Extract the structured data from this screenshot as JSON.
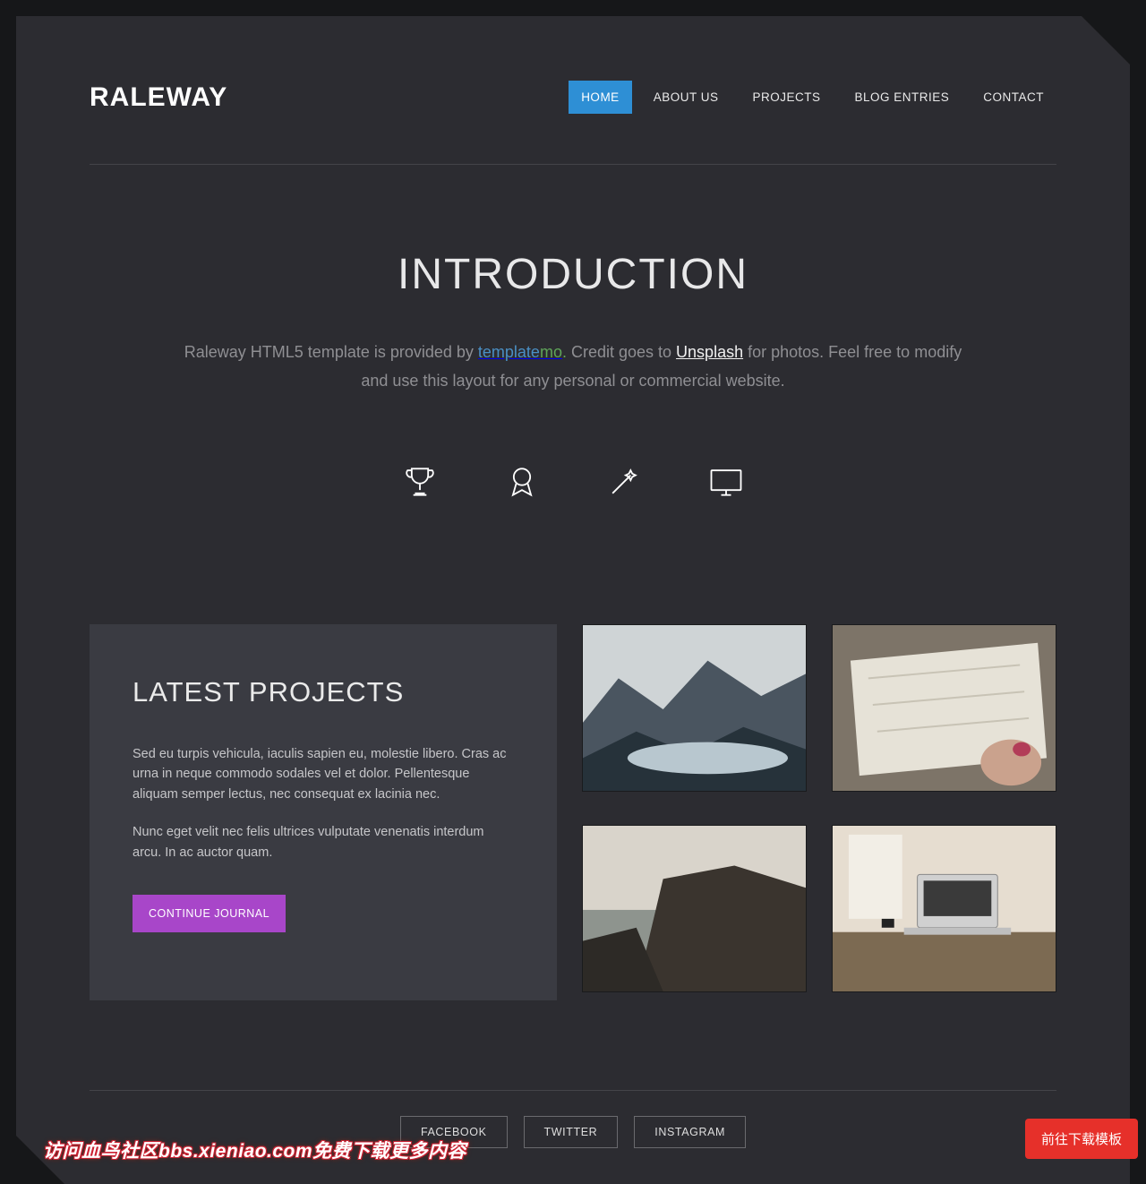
{
  "header": {
    "logo": "RALEWAY",
    "nav": {
      "home": "HOME",
      "about": "ABOUT US",
      "projects": "PROJECTS",
      "blog": "BLOG ENTRIES",
      "contact": "CONTACT"
    }
  },
  "intro": {
    "title": "INTRODUCTION",
    "text_before_link": "Raleway HTML5 template is provided by ",
    "link_tm1": "template",
    "link_tm2": "mo",
    "link_dot": ".",
    "text_mid": " Credit goes to ",
    "link_unsplash": "Unsplash",
    "text_after": " for photos. Feel free to modify and use this layout for any personal or commercial website."
  },
  "icons": {
    "trophy": "trophy",
    "badge": "badge",
    "wand": "wand",
    "monitor": "monitor"
  },
  "projects": {
    "title": "LATEST PROJECTS",
    "p1": "Sed eu turpis vehicula, iaculis sapien eu, molestie libero. Cras ac urna in neque commodo sodales vel et dolor. Pellentesque aliquam semper lectus, nec consequat ex lacinia nec.",
    "p2": "Nunc eget velit nec felis ultrices vulputate venenatis interdum arcu. In ac auctor quam.",
    "cta": "CONTINUE JOURNAL",
    "thumbs": {
      "img1": "mountain-lake",
      "img2": "map-in-hands",
      "img3": "coastal-cliff",
      "img4": "desk-laptop"
    }
  },
  "social": {
    "facebook": "FACEBOOK",
    "twitter": "TWITTER",
    "instagram": "INSTAGRAM"
  },
  "download_btn": "前往下载模板",
  "watermark": "访问血鸟社区bbs.xieniao.com免费下载更多内容"
}
